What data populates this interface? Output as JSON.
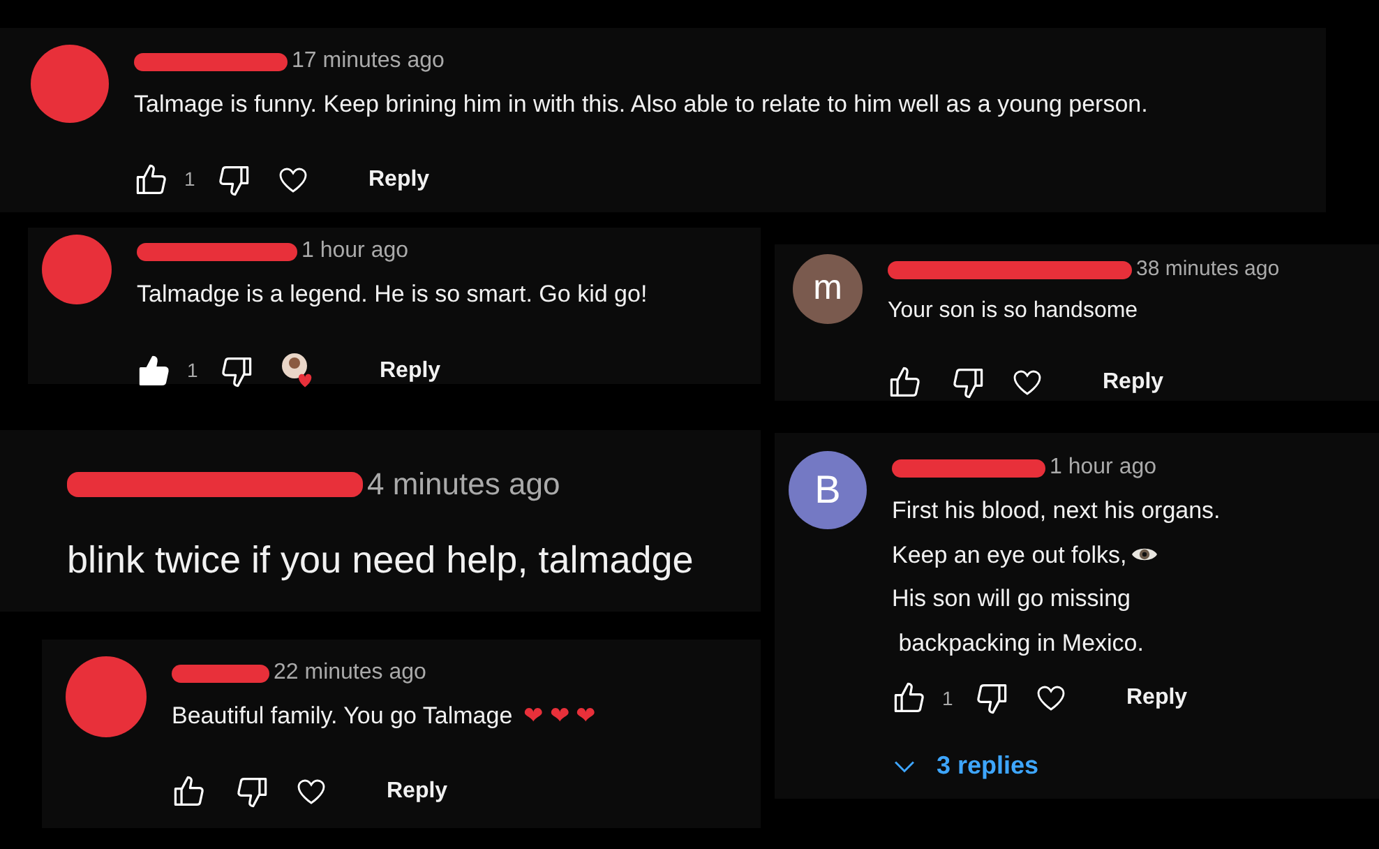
{
  "comments": [
    {
      "avatar": {
        "kind": "redacted"
      },
      "time": "17 minutes ago",
      "text": "Talmage is funny. Keep brining him in with this. Also able to relate to him well as a young person.",
      "actions": {
        "liked": false,
        "likes": "1",
        "creator_heart": false,
        "reply": "Reply"
      }
    },
    {
      "avatar": {
        "kind": "redacted"
      },
      "time": "1 hour ago",
      "text": "Talmadge is a legend. He is so smart. Go kid go!",
      "actions": {
        "liked": true,
        "likes": "1",
        "creator_heart": true,
        "reply": "Reply"
      }
    },
    {
      "avatar": {
        "kind": "letter",
        "letter": "m",
        "color": "#7a5a4e"
      },
      "time": "38 minutes ago",
      "text": "Your son is so handsome",
      "actions": {
        "liked": false,
        "creator_heart": false,
        "reply": "Reply"
      }
    },
    {
      "time": "4 minutes ago",
      "text": "blink twice if you need help, talmadge"
    },
    {
      "avatar": {
        "kind": "redacted"
      },
      "time": "22 minutes ago",
      "text": "Beautiful family. You go Talmage",
      "emoji": "❤ ❤ ❤",
      "actions": {
        "liked": false,
        "creator_heart": false,
        "reply": "Reply"
      }
    },
    {
      "avatar": {
        "kind": "letter",
        "letter": "B",
        "color": "#7479c4"
      },
      "time": "1 hour ago",
      "lines": [
        "First his blood, next his organs.",
        "Keep an eye out folks,",
        "His son will go missing",
        " backpacking in Mexico."
      ],
      "actions": {
        "liked": false,
        "likes": "1",
        "creator_heart": false,
        "reply": "Reply"
      },
      "replies": "3 replies"
    }
  ]
}
